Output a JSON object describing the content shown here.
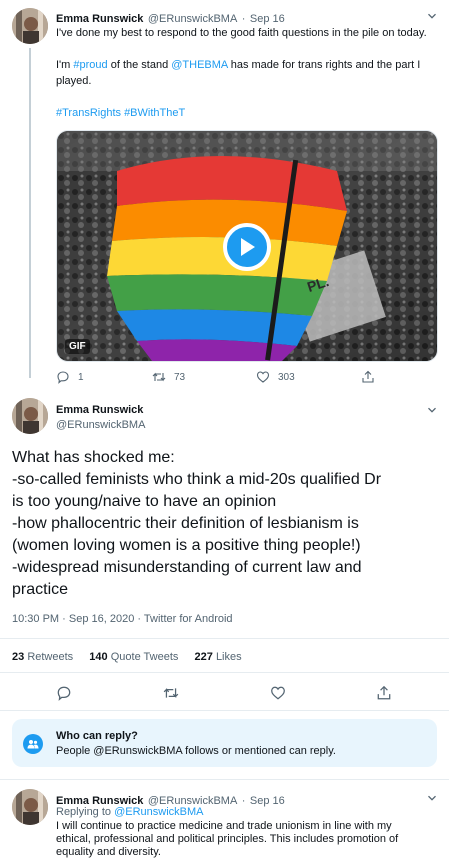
{
  "tweet1": {
    "name": "Emma Runswick",
    "handle": "@ERunswickBMA",
    "date": "Sep 16",
    "para1": "I've done my best to respond to the good faith questions in the pile on today.",
    "para2_pre": "I'm ",
    "para2_tag": "#proud",
    "para2_mid": " of the stand ",
    "para2_mention": "@THEBMA",
    "para2_post": " has made for trans rights and the part I played.",
    "hashtags": "#TransRights #BWithTheT",
    "media_badge": "GIF",
    "media_banner_text": "PL.",
    "replies": "1",
    "retweets": "73",
    "likes": "303"
  },
  "main": {
    "name": "Emma Runswick",
    "handle": "@ERunswickBMA",
    "lines": [
      "What has shocked me:",
      "-so-called feminists who think a mid-20s qualified Dr",
      "is too young/naive to have an opinion",
      "-how phallocentric their definition of lesbianism is",
      "(women loving women is a positive thing people!)",
      "-widespread misunderstanding of current law and",
      "practice"
    ],
    "timestamp": "10:30 PM · Sep 16, 2020 · Twitter for Android",
    "retweets_count": "23",
    "retweets_label": "Retweets",
    "quotes_count": "140",
    "quotes_label": "Quote Tweets",
    "likes_count": "227",
    "likes_label": "Likes"
  },
  "who_can_reply": {
    "title": "Who can reply?",
    "body": "People @ERunswickBMA follows or mentioned can reply."
  },
  "tweet3": {
    "name": "Emma Runswick",
    "handle": "@ERunswickBMA",
    "date": "Sep 16",
    "replying_prefix": "Replying to ",
    "replying_to": "@ERunswickBMA",
    "text": [
      "I will continue to practice medicine and trade unionism in line with my",
      "ethical, professional and political principles. This includes promotion of",
      "equality and diversity."
    ]
  },
  "colors": {
    "accent": "#1d9bf0",
    "secondary_text": "#536471",
    "reply_box_bg": "#e8f5fd"
  },
  "icons": [
    "chevron-down-icon",
    "reply-icon",
    "retweet-icon",
    "like-icon",
    "share-icon",
    "play-icon",
    "people-icon"
  ]
}
